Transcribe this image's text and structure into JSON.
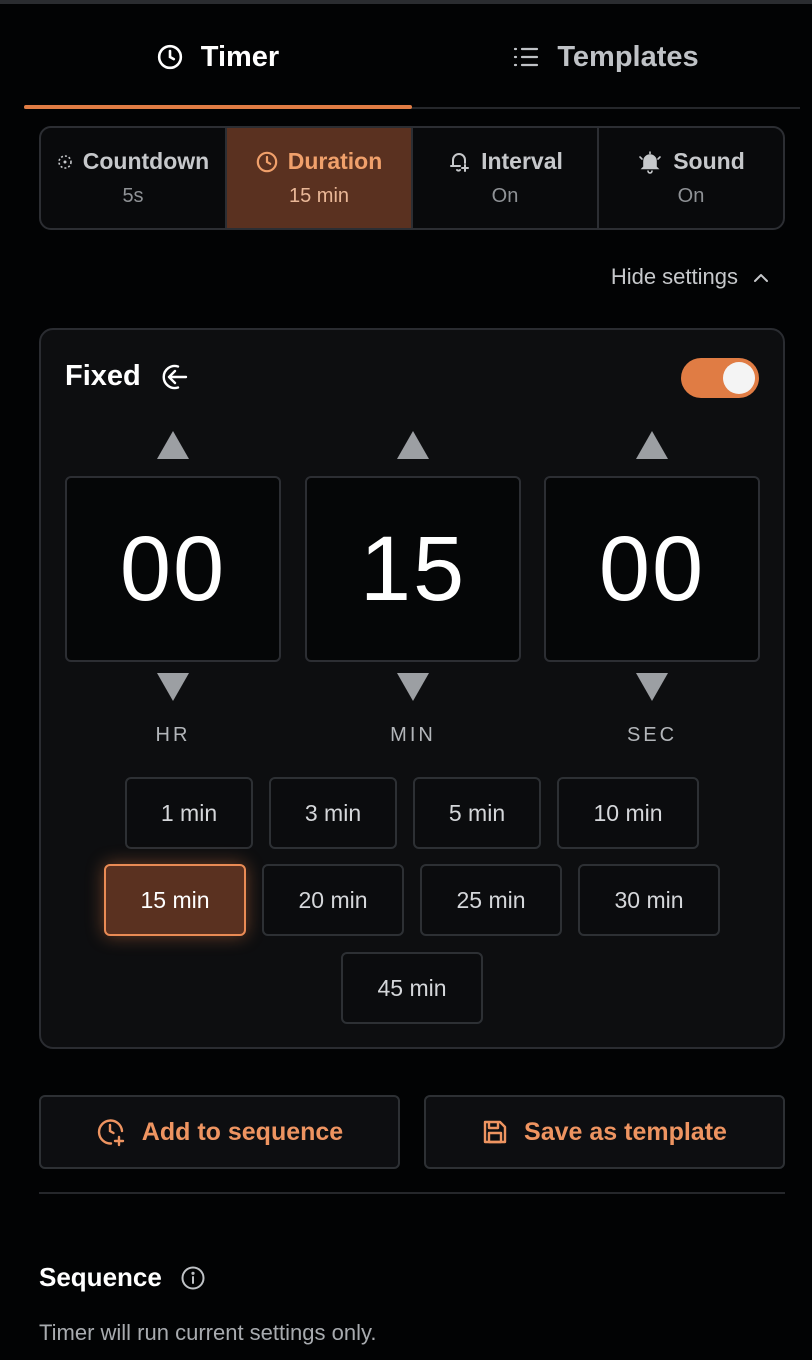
{
  "tabs": [
    {
      "label": "Timer",
      "icon": "clock-icon",
      "active": true
    },
    {
      "label": "Templates",
      "icon": "list-icon",
      "active": false
    }
  ],
  "settings": [
    {
      "title": "Countdown",
      "value": "5s",
      "icon": "countdown-icon"
    },
    {
      "title": "Duration",
      "value": "15 min",
      "icon": "clock-icon",
      "active": true
    },
    {
      "title": "Interval",
      "value": "On",
      "icon": "bell-plus-icon"
    },
    {
      "title": "Sound",
      "value": "On",
      "icon": "bell-ring-icon"
    }
  ],
  "hide_settings": "Hide settings",
  "mode": {
    "title": "Fixed",
    "icon": "arrow-left-circle-icon",
    "toggle_on": true
  },
  "time": {
    "hours": "00",
    "minutes": "15",
    "seconds": "00",
    "hr_label": "HR",
    "min_label": "MIN",
    "sec_label": "SEC"
  },
  "presets": {
    "row1": [
      "1 min",
      "3 min",
      "5 min",
      "10 min"
    ],
    "row2": [
      "15 min",
      "20 min",
      "25 min",
      "30 min"
    ],
    "row3": [
      "45 min"
    ],
    "selected": "15 min"
  },
  "actions": {
    "add_to_sequence": "Add to sequence",
    "save_as_template": "Save as template"
  },
  "sequence": {
    "title": "Sequence",
    "description": "Timer will run current settings only."
  },
  "colors": {
    "accent": "#e07c44",
    "background": "#020304",
    "card": "#0d0e10"
  }
}
